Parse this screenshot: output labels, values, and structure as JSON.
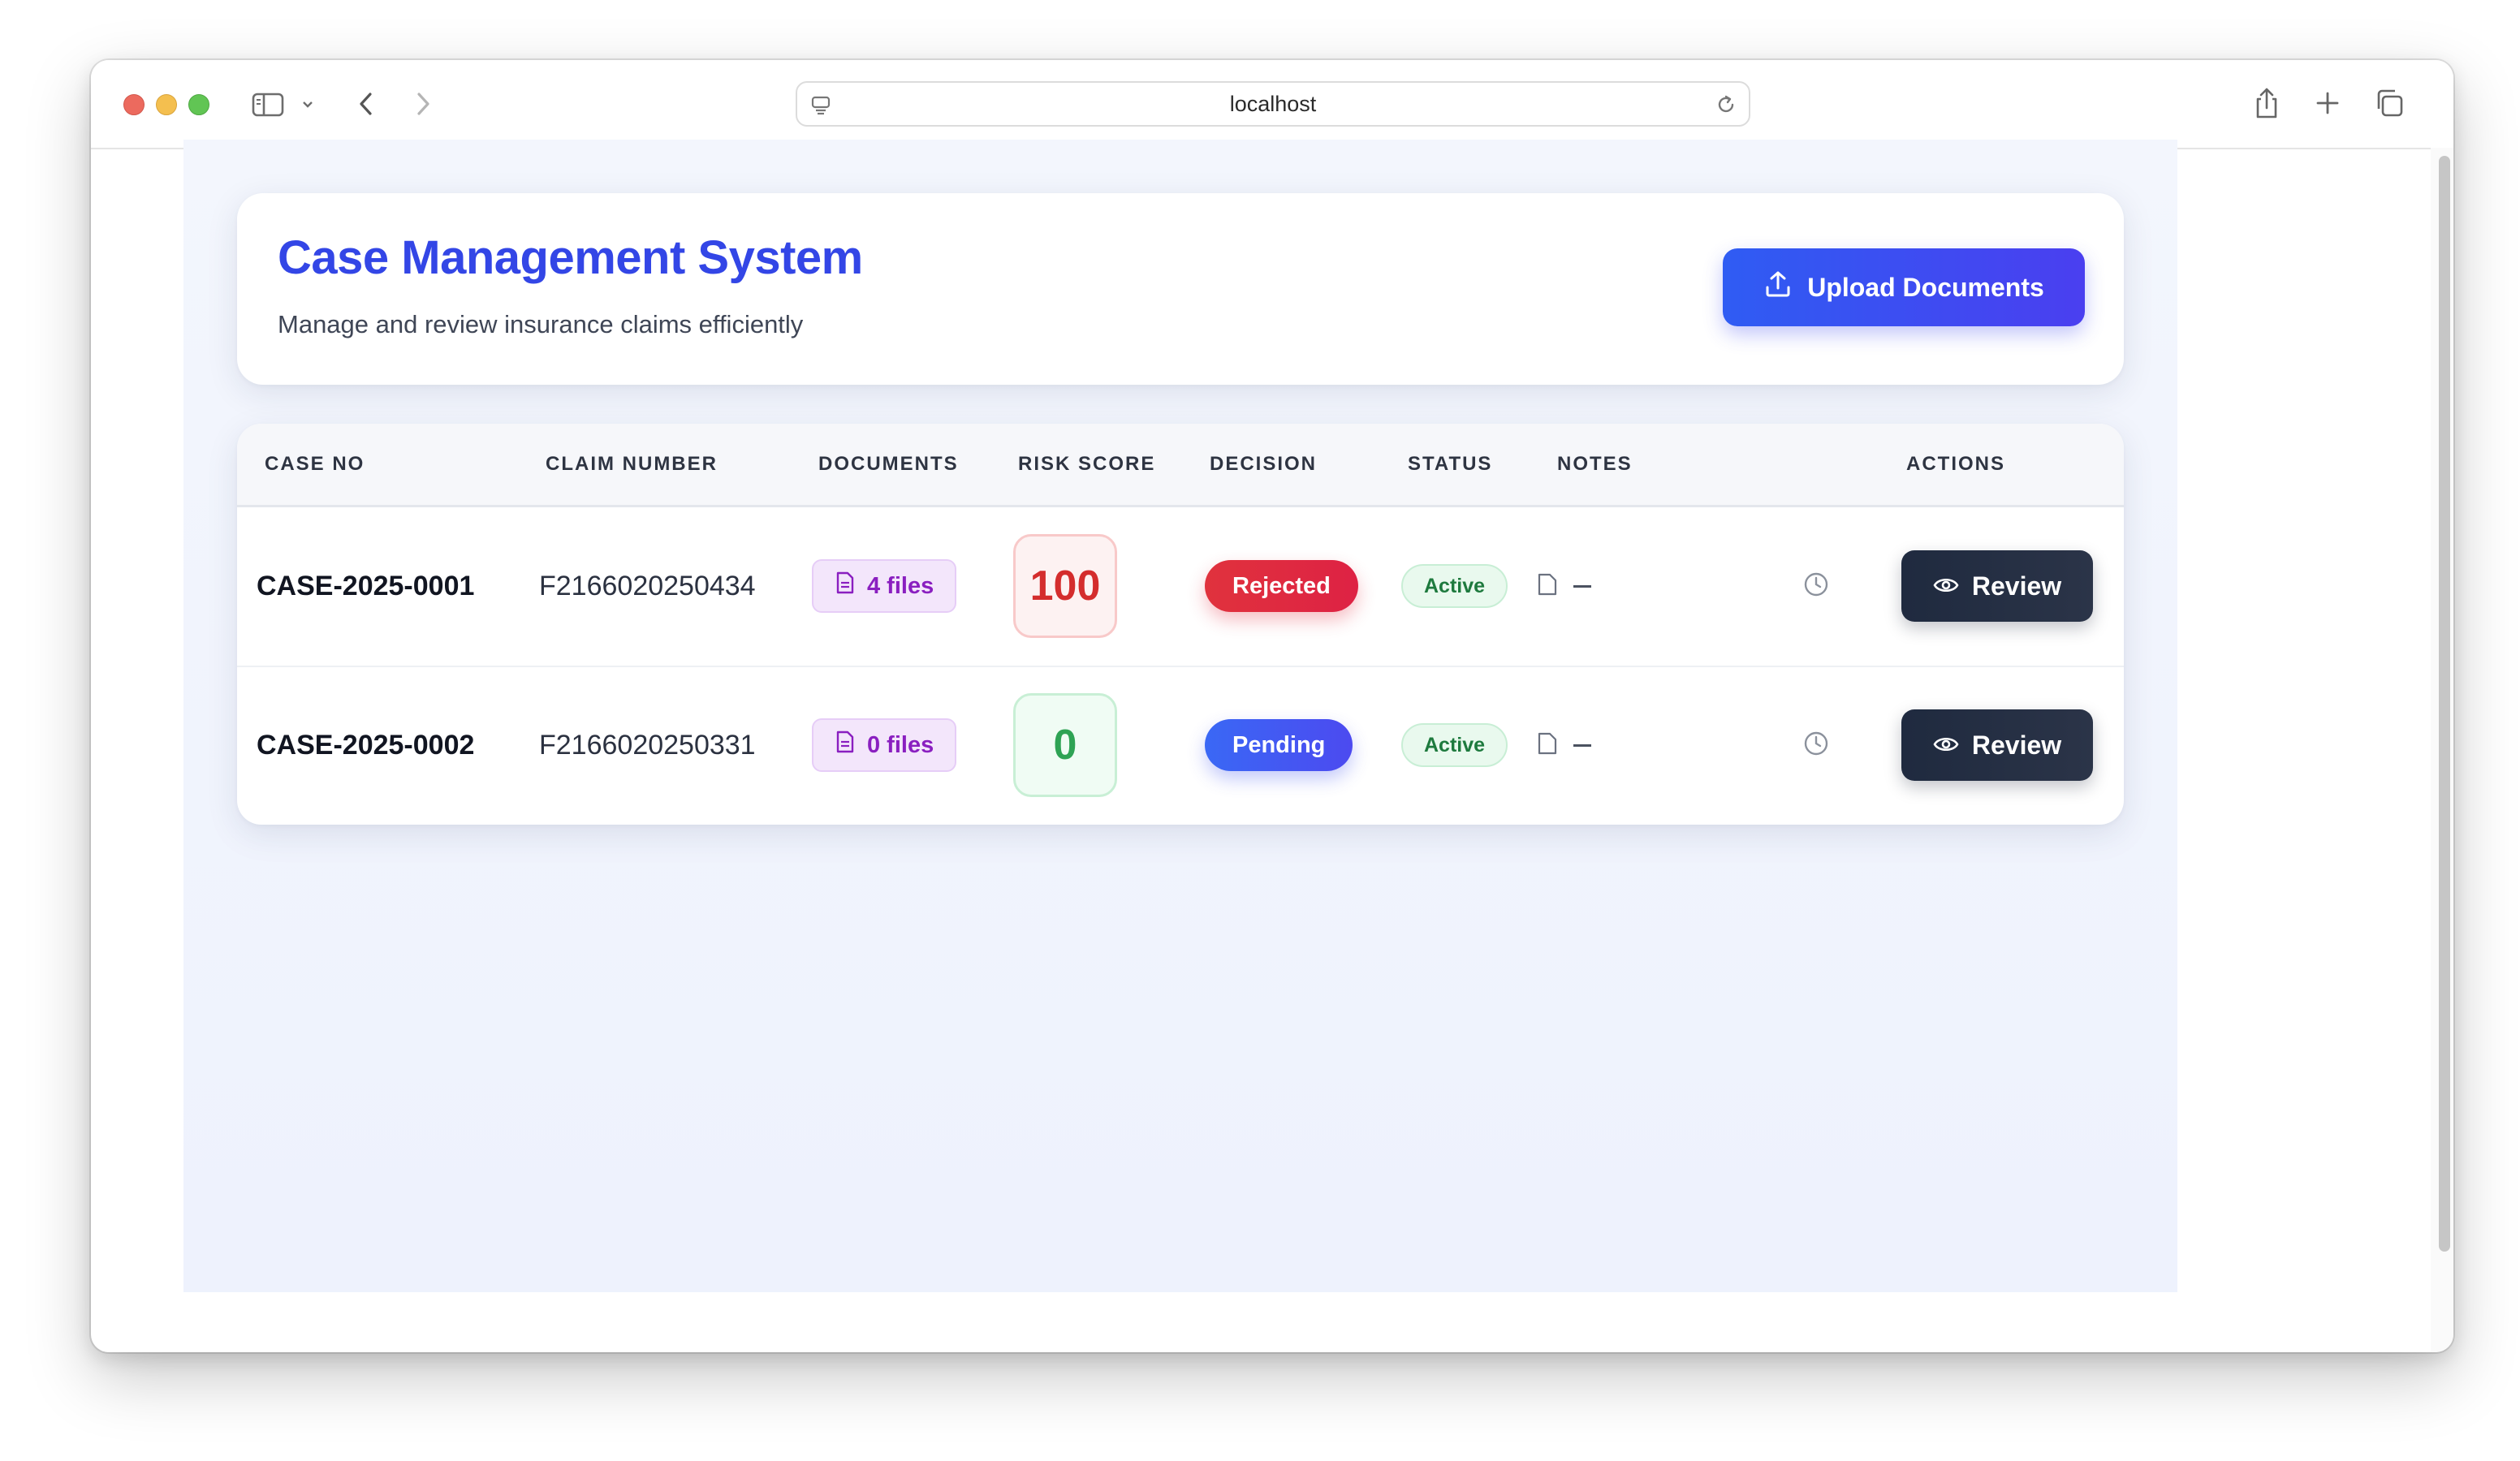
{
  "browser": {
    "url": "localhost"
  },
  "header": {
    "title": "Case Management System",
    "subtitle": "Manage and review insurance claims efficiently",
    "upload_label": "Upload Documents"
  },
  "table": {
    "columns": [
      "CASE NO",
      "CLAIM NUMBER",
      "DOCUMENTS",
      "RISK SCORE",
      "DECISION",
      "STATUS",
      "NOTES",
      "ACTIONS"
    ],
    "rows": [
      {
        "case_no": "CASE-2025-0001",
        "claim_number": "F2166020250434",
        "documents": "4 files",
        "risk_score": "100",
        "decision": "Rejected",
        "status": "Active",
        "notes": "—",
        "action_label": "Review"
      },
      {
        "case_no": "CASE-2025-0002",
        "claim_number": "F2166020250331",
        "documents": "0 files",
        "risk_score": "0",
        "decision": "Pending",
        "status": "Active",
        "notes": "—",
        "action_label": "Review"
      }
    ]
  },
  "colors": {
    "accent": "#3346e6",
    "rejected": "#e0323d",
    "pending": "#3a68f5",
    "active": "#1e7a3e",
    "risk_high": "#d42d2d",
    "risk_low": "#2ea354"
  },
  "icons": {
    "upload": "upload-icon",
    "document": "document-icon",
    "note": "note-icon",
    "history": "clock-icon",
    "review": "eye-icon"
  }
}
